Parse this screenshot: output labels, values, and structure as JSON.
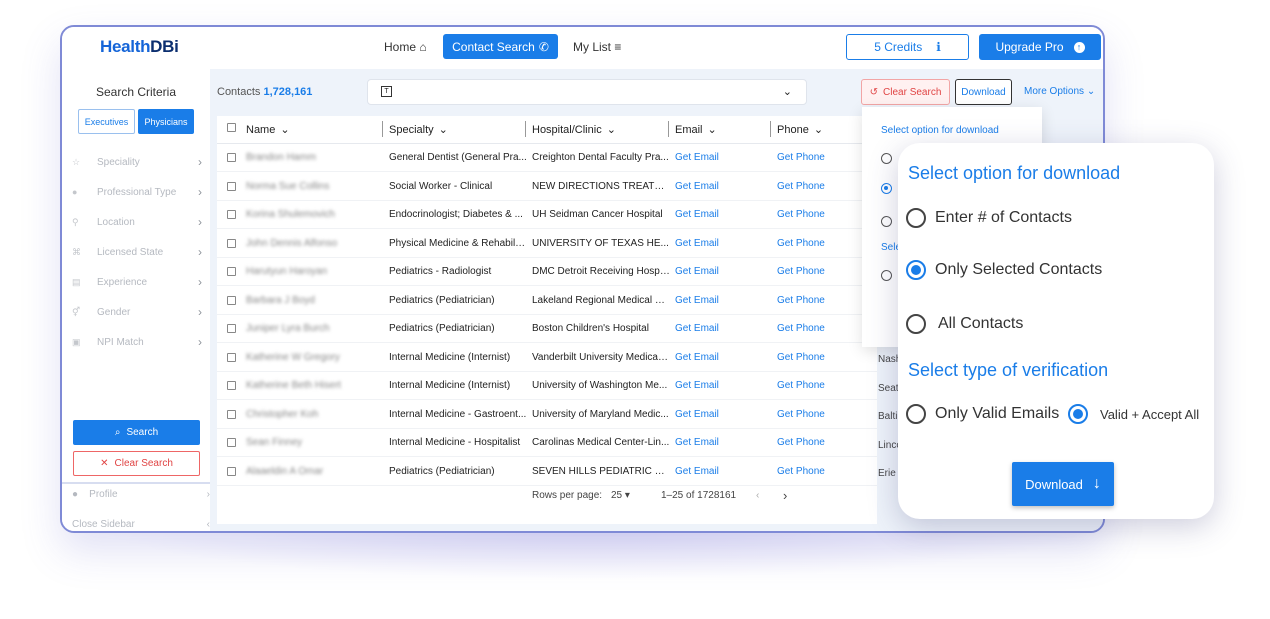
{
  "brand": {
    "logo_main": "Health",
    "logo_accent": "DBi"
  },
  "nav": {
    "home": "Home",
    "home_icon": "home-icon",
    "contact_search": "Contact Search",
    "contact_icon": "phone-icon",
    "my_list": "My List",
    "list_icon": "list-icon",
    "credits": "5 Credits",
    "credits_icon": "info-icon",
    "upgrade": "Upgrade Pro",
    "upgrade_icon": "arrow-up-circle-icon"
  },
  "sidebar": {
    "title": "Search Criteria",
    "tabs": [
      "Executives",
      "Physicians"
    ],
    "active_tab": "Physicians",
    "items": [
      {
        "label": "Speciality",
        "icon": "star-icon"
      },
      {
        "label": "Professional Type",
        "icon": "person-icon"
      },
      {
        "label": "Location",
        "icon": "location-pin-icon"
      },
      {
        "label": "Licensed State",
        "icon": "badge-icon"
      },
      {
        "label": "Experience",
        "icon": "briefcase-icon"
      },
      {
        "label": "Gender",
        "icon": "gender-icon"
      },
      {
        "label": "NPI Match",
        "icon": "id-card-icon"
      }
    ],
    "search_button": "Search",
    "clear_button": "Clear Search",
    "profile": "Profile",
    "close_sidebar": "Close Sidebar"
  },
  "toolbar": {
    "contacts_label": "Contacts",
    "contacts_count": "1,728,161",
    "clear_search": "Clear Search",
    "download": "Download",
    "more_options": "More Options"
  },
  "table": {
    "columns": [
      "Name",
      "Specialty",
      "Hospital/Clinic",
      "Email",
      "Phone"
    ],
    "rows": [
      {
        "name": "Brandon Hamm",
        "specialty": "General Dentist (General Pra...",
        "hospital": "Creighton Dental Faculty Pra...",
        "email": "Get Email",
        "phone": "Get Phone"
      },
      {
        "name": "Norma Sue Collins",
        "specialty": "Social Worker - Clinical",
        "hospital": "NEW DIRECTIONS TREATM...",
        "email": "Get Email",
        "phone": "Get Phone"
      },
      {
        "name": "Korina Shulemovich",
        "specialty": "Endocrinologist; Diabetes & ...",
        "hospital": "UH Seidman Cancer Hospital",
        "email": "Get Email",
        "phone": "Get Phone"
      },
      {
        "name": "John Dennis Alfonso",
        "specialty": "Physical Medicine & Rehabilit...",
        "hospital": "UNIVERSITY OF TEXAS HE...",
        "email": "Get Email",
        "phone": "Get Phone"
      },
      {
        "name": "Harutyun Haroyan",
        "specialty": "Pediatrics - Radiologist",
        "hospital": "DMC Detroit Receiving Hospital",
        "email": "Get Email",
        "phone": "Get Phone"
      },
      {
        "name": "Barbara J Boyd",
        "specialty": "Pediatrics (Pediatrician)",
        "hospital": "Lakeland Regional Medical C...",
        "email": "Get Email",
        "phone": "Get Phone"
      },
      {
        "name": "Juniper Lyra Burch",
        "specialty": "Pediatrics (Pediatrician)",
        "hospital": "Boston Children's Hospital",
        "email": "Get Email",
        "phone": "Get Phone"
      },
      {
        "name": "Katherine W Gregory",
        "specialty": "Internal Medicine (Internist)",
        "hospital": "Vanderbilt University Medical ...",
        "email": "Get Email",
        "phone": "Get Phone"
      },
      {
        "name": "Katherine Beth Hisert",
        "specialty": "Internal Medicine (Internist)",
        "hospital": "University of Washington Me...",
        "email": "Get Email",
        "phone": "Get Phone"
      },
      {
        "name": "Christopher Koh",
        "specialty": "Internal Medicine - Gastroent...",
        "hospital": "University of Maryland Medic...",
        "email": "Get Email",
        "phone": "Get Phone"
      },
      {
        "name": "Sean Finney",
        "specialty": "Internal Medicine - Hospitalist",
        "hospital": "Carolinas Medical Center-Lin...",
        "email": "Get Email",
        "phone": "Get Phone"
      },
      {
        "name": "Alaaeldin A Omar",
        "specialty": "Pediatrics (Pediatrician)",
        "hospital": "SEVEN HILLS PEDIATRIC C...",
        "email": "Get Email",
        "phone": "Get Phone"
      }
    ],
    "city_fragments": [
      "Nash",
      "Seatt",
      "Baltin",
      "Linco",
      "Erie"
    ],
    "rows_per_page_label": "Rows per page:",
    "rows_per_page": "25",
    "range": "1–25 of 1728161"
  },
  "download_panel": {
    "title": "Select option for download",
    "options": [
      "Enter # of Contacts",
      "Only Selected Contacts",
      "All Contacts"
    ],
    "selected_option": "Only Selected Contacts",
    "verification_title": "Select type of verification",
    "verification_title_short": "Sele",
    "verification_options": [
      "Only Valid Emails",
      "Valid + Accept All"
    ],
    "selected_verification": "Valid + Accept All",
    "download_button": "Download",
    "download_icon": "arrow-down-icon"
  },
  "colors": {
    "accent": "#1a7de8",
    "danger": "#e04444",
    "frame": "#7f8ad6"
  }
}
